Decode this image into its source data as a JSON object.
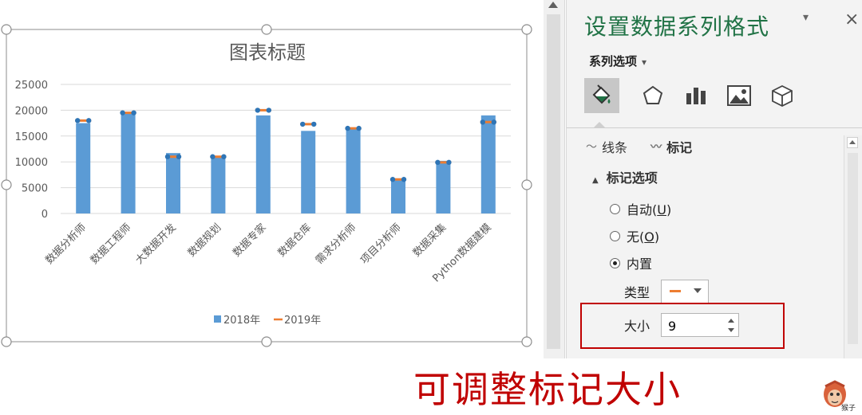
{
  "chart_data": {
    "type": "bar",
    "title": "图表标题",
    "categories": [
      "数据分析师",
      "数据工程师",
      "大数据开发",
      "数据规划",
      "数据专家",
      "数据仓库",
      "需求分析师",
      "项目分析师",
      "数据采集",
      "Python数据建模"
    ],
    "series": [
      {
        "name": "2018年",
        "type": "bar",
        "color": "#5b9bd5",
        "values": [
          17500,
          19500,
          11700,
          11000,
          19000,
          16000,
          16500,
          6800,
          10200,
          19000
        ]
      },
      {
        "name": "2019年",
        "type": "line-marker",
        "color": "#ed7d31",
        "values": [
          18000,
          19500,
          11000,
          11000,
          20000,
          17300,
          16500,
          6600,
          9900,
          17700
        ]
      }
    ],
    "ylim": [
      0,
      25000
    ],
    "yticks": [
      "0",
      "5000",
      "10000",
      "15000",
      "20000",
      "25000"
    ],
    "grid": true,
    "legend": "bottom",
    "xlabel": "",
    "ylabel": ""
  },
  "pane": {
    "title": "设置数据系列格式",
    "dropdown_icon": "▾",
    "close_icon": "×",
    "series_options_label": "系列选项",
    "series_options_caret": "▾",
    "tabs": {
      "line": "线条",
      "marker": "标记"
    },
    "section": "标记选项",
    "radio_auto": {
      "text": "自动(",
      "key": "U",
      "close": ")"
    },
    "radio_none": {
      "text": "无(",
      "key": "O",
      "close": ")"
    },
    "radio_builtin": "内置",
    "type_label": "类型",
    "size_label": "大小",
    "size_value": "9"
  },
  "caption": "可调整标记大小",
  "logo_text": "猴子",
  "colors": {
    "accent": "#217346",
    "highlight": "#c00000",
    "bar": "#5b9bd5",
    "marker": "#ed7d31"
  }
}
